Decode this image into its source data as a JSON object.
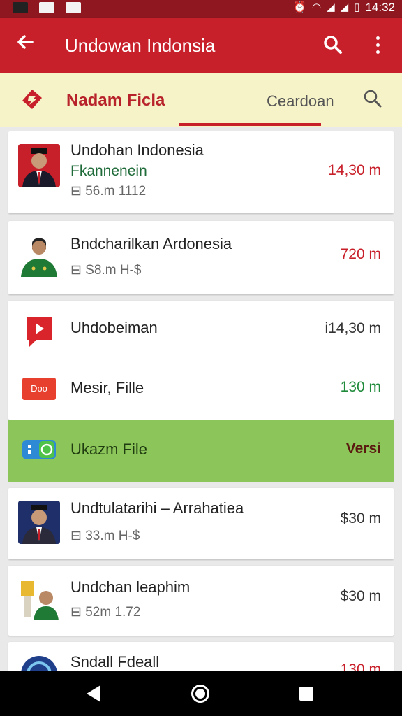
{
  "status_bar": {
    "time": "14:32"
  },
  "app_bar": {
    "title": "Undowan Indonsia"
  },
  "sub_bar": {
    "title": "Nadam Ficla",
    "tab": "Ceardoan"
  },
  "items": [
    {
      "name": "Undohan Indonesia",
      "subtitle": "Fkannenein",
      "meta": "⊟ 56.m 1112",
      "size": "14,30 m"
    },
    {
      "name": "Bndcharilkan Ardonesia",
      "meta": "⊟ S8.m H-$",
      "size": "720 m"
    },
    {
      "name": "Uhdobeiman",
      "size": "i14,30 m"
    },
    {
      "name": "Mesir, Fille",
      "icon_label": "Doo",
      "size": "130 m"
    },
    {
      "name": "Ukazm File",
      "size": "Versi"
    },
    {
      "name": "Undtulatarihi – Arrahatiea",
      "meta": "⊟ 33.m H-$",
      "size": "$30 m"
    },
    {
      "name": "Undchan leaphim",
      "meta": "⊟ 52m 1.72",
      "size": "$30 m"
    },
    {
      "name": "Sndall Fdeall",
      "size": "130 m"
    }
  ],
  "colors": {
    "primary": "#c8202a",
    "status_bar": "#8e1720",
    "sub_bar": "#f6f3c8",
    "highlight_row": "#8cc65a"
  }
}
